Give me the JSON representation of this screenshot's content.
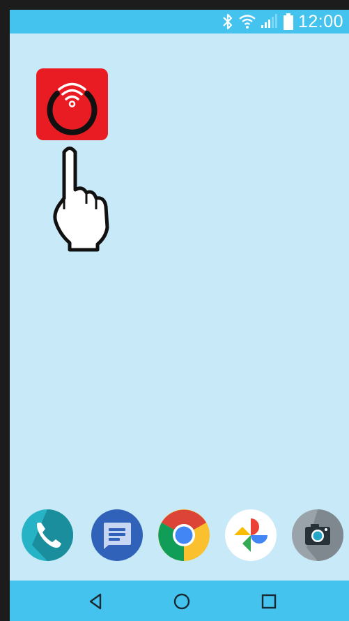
{
  "status_bar": {
    "time": "12:00",
    "icons": [
      "bluetooth-icon",
      "wifi-icon",
      "signal-icon",
      "battery-icon"
    ],
    "color": "#45c3ef"
  },
  "home": {
    "app_icon": {
      "icon": "wifi-power-app-icon",
      "color": "#e91c24"
    },
    "gesture": {
      "icon": "tap-hand-icon"
    }
  },
  "dock": {
    "apps": [
      {
        "icon": "phone-icon",
        "color": "#1fa3b5"
      },
      {
        "icon": "messages-icon",
        "color": "#2f62b8"
      },
      {
        "icon": "chrome-icon",
        "color": "#db4437"
      },
      {
        "icon": "photos-icon",
        "color": "#ffffff"
      },
      {
        "icon": "camera-icon",
        "color": "#9aa3aa"
      }
    ]
  },
  "nav_bar": {
    "buttons": [
      "back-icon",
      "home-icon",
      "recents-icon"
    ],
    "color": "#45c3ef"
  }
}
